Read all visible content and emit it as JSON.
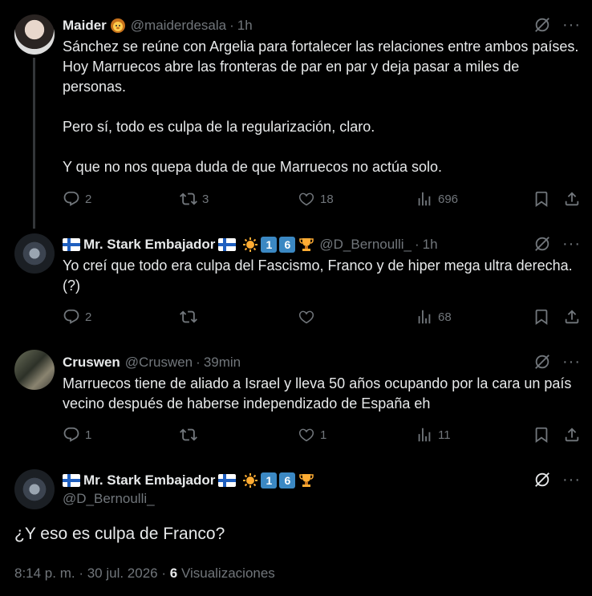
{
  "tweets": [
    {
      "name": "Maider",
      "handle": "@maiderdesala",
      "time": "1h",
      "paragraphs": [
        "Sánchez se reúne con Argelia para fortalecer las relaciones entre ambos países. Hoy Marruecos abre las fronteras de par en par y deja pasar a miles de personas.",
        "Pero sí, todo es culpa de la regularización, claro.",
        "Y que no nos quepa duda de que Marruecos no actúa solo."
      ],
      "replies": "2",
      "reposts": "3",
      "likes": "18",
      "views": "696"
    },
    {
      "name": "Mr. Stark Embajador",
      "handle": "@D_Bernoulli_",
      "time": "1h",
      "keycaps": [
        "1",
        "6"
      ],
      "paragraphs": [
        "Yo creí que todo era culpa del Fascismo, Franco y de hiper mega ultra derecha. (?)"
      ],
      "replies": "2",
      "reposts": "",
      "likes": "",
      "views": "68"
    },
    {
      "name": "Cruswen",
      "handle": "@Cruswen",
      "time": "39min",
      "paragraphs": [
        "Marruecos tiene de aliado a Israel y lleva 50 años ocupando por la cara un país vecino después de haberse independizado de España eh"
      ],
      "replies": "1",
      "reposts": "",
      "likes": "1",
      "views": "11"
    }
  ],
  "focused": {
    "name": "Mr. Stark Embajador",
    "handle": "@D_Bernoulli_",
    "keycaps": [
      "1",
      "6"
    ],
    "text": "¿Y eso es culpa de Franco?",
    "datetime": "8:14 p. m. · 30 jul. 2026 ·",
    "views_count": "6",
    "views_label": "Visualizaciones"
  },
  "icons": {
    "more": "more-horizontal-icon",
    "grok": "grok-icon",
    "reply": "reply-icon",
    "repost": "repost-icon",
    "like": "heart-icon",
    "views": "views-chart-icon",
    "bookmark": "bookmark-icon",
    "share": "share-icon"
  },
  "colors": {
    "background": "#000000",
    "text": "#e7e9ea",
    "muted": "#71767b",
    "line": "#333639"
  }
}
